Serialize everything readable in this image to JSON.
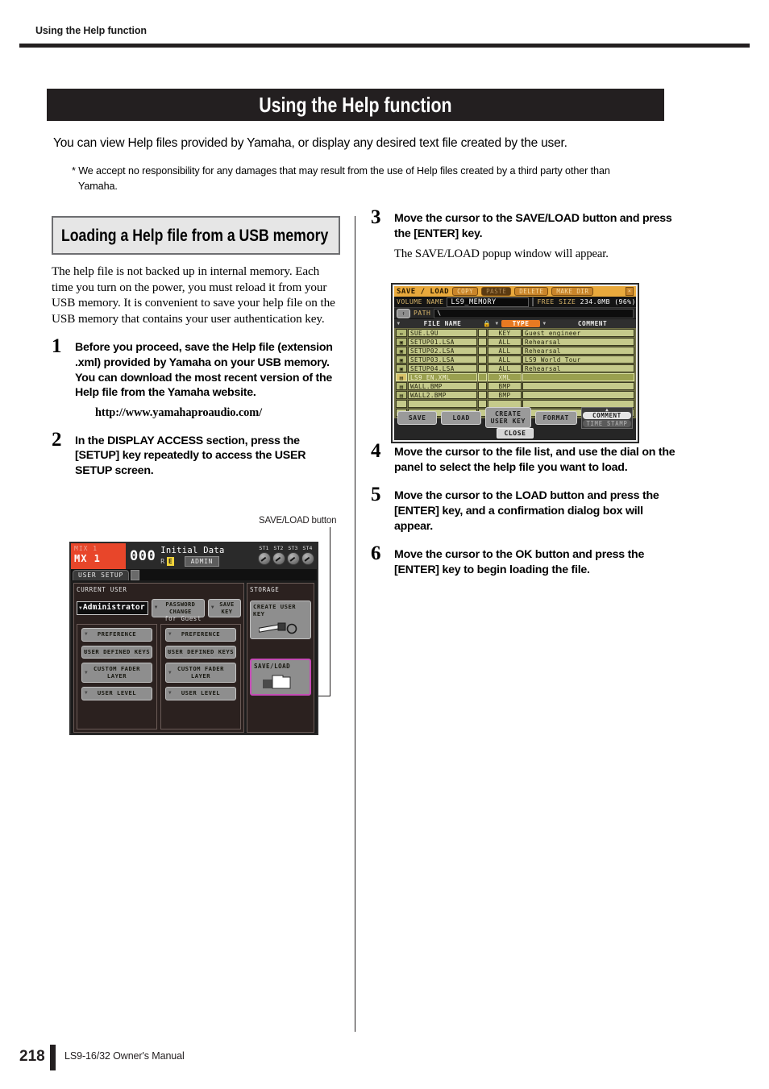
{
  "running_head": "Using the Help function",
  "title_banner": "Using the Help function",
  "intro": "You can view Help files provided by Yamaha, or display any desired text file created by the user.",
  "footnote": "* We accept no responsibility for any damages that may result from the use of Help files created by a third party other than Yamaha.",
  "section": {
    "heading": "Loading a Help file from a USB memory",
    "body": "The help file is not backed up in internal memory. Each time you turn on the power, you must reload it from your USB memory. It is convenient to save your help file on the USB memory that contains your user authentication key."
  },
  "steps": [
    {
      "num": "1",
      "text": "Before you proceed, save the Help file (extension .xml) provided by Yamaha on your USB memory. You can download the most recent version of the Help file from the Yamaha website.",
      "url": "http://www.yamahaproaudio.com/"
    },
    {
      "num": "2",
      "text": "In the DISPLAY ACCESS section, press the [SETUP] key repeatedly to access the USER SETUP screen."
    },
    {
      "num": "3",
      "text": "Move the cursor to the SAVE/LOAD button and press the [ENTER] key.",
      "sub": "The SAVE/LOAD popup window will appear."
    },
    {
      "num": "4",
      "text": "Move the cursor to the file list, and use the dial on the panel to select the help file you want to load."
    },
    {
      "num": "5",
      "text": "Move the cursor to the LOAD button and press the [ENTER] key, and a confirmation dialog box will appear."
    },
    {
      "num": "6",
      "text": "Move the cursor to the OK button and press the [ENTER] key to begin loading the file."
    }
  ],
  "callout": {
    "saveload_button": "SAVE/LOAD button"
  },
  "saveload_popup": {
    "title": "SAVE / LOAD",
    "toolbar": {
      "copy": "COPY",
      "paste": "PASTE",
      "delete": "DELETE",
      "make_dir": "MAKE DIR",
      "close_x": "×"
    },
    "volume_label": "VOLUME NAME",
    "volume_name": "LS9_MEMORY",
    "free_label": "FREE SIZE",
    "free_value": "234.0MB (96%)",
    "up_icon": "↑",
    "path_label": "PATH",
    "path_value": "\\",
    "columns": {
      "file_name": "FILE NAME",
      "lock": "▲",
      "type": "TYPE",
      "comment": "COMMENT"
    },
    "files": [
      {
        "icon": "↔",
        "name": "SUE.L9U",
        "type": "KEY",
        "comment": "Guest engineer",
        "selected": false
      },
      {
        "icon": "▣",
        "name": "SETUP01.LSA",
        "type": "ALL",
        "comment": "Rehearsal",
        "selected": false
      },
      {
        "icon": "▣",
        "name": "SETUP02.LSA",
        "type": "ALL",
        "comment": "Rehearsal",
        "selected": false
      },
      {
        "icon": "▣",
        "name": "SETUP03.LSA",
        "type": "ALL",
        "comment": "LS9 World Tour",
        "selected": false
      },
      {
        "icon": "▣",
        "name": "SETUP04.LSA",
        "type": "ALL",
        "comment": "Rehearsal",
        "selected": false
      },
      {
        "icon": "▤",
        "name": "LS9_EN.XML",
        "type": "XML",
        "comment": "",
        "selected": true
      },
      {
        "icon": "▤",
        "name": "WALL.BMP",
        "type": "BMP",
        "comment": "",
        "selected": false
      },
      {
        "icon": "▤",
        "name": "WALL2.BMP",
        "type": "BMP",
        "comment": "",
        "selected": false
      }
    ],
    "buttons": {
      "save": "SAVE",
      "load": "LOAD",
      "create_user_key": "CREATE USER KEY",
      "format": "FORMAT",
      "comment": "COMMENT",
      "time_stamp": "TIME STAMP",
      "close": "CLOSE"
    },
    "colors": {
      "titlebar": "#e9a93c",
      "list_bg": "#c5ca8b",
      "selected": "#9aa04f",
      "type_header": "#e87a22"
    }
  },
  "user_setup_screen": {
    "mix_label_small": "MIX 1",
    "mix_label_large": "MX 1",
    "scene_number": "000",
    "scene_name": "Initial Data",
    "scene_r": "R",
    "scene_e": "E",
    "admin_badge": "ADMIN",
    "knobs": [
      "ST1",
      "ST2",
      "ST3",
      "ST4"
    ],
    "tab": "USER SETUP",
    "current_user_title": "CURRENT USER",
    "current_user_name": "Administrator",
    "password_change": "PASSWORD CHANGE",
    "save_key": "SAVE KEY",
    "for_guest": "for Guest",
    "left_buttons": [
      "PREFERENCE",
      "USER DEFINED KEYS",
      "CUSTOM FADER LAYER",
      "USER LEVEL"
    ],
    "guest_buttons": [
      "PREFERENCE",
      "USER DEFINED KEYS",
      "CUSTOM FADER LAYER",
      "USER LEVEL"
    ],
    "storage_title": "STORAGE",
    "create_user_key": "CREATE USER KEY",
    "save_load": "SAVE/LOAD",
    "accent_color": "#c44bb5",
    "mix_color": "#e8462a"
  },
  "footer": {
    "page_number": "218",
    "manual": "LS9-16/32  Owner's Manual"
  }
}
